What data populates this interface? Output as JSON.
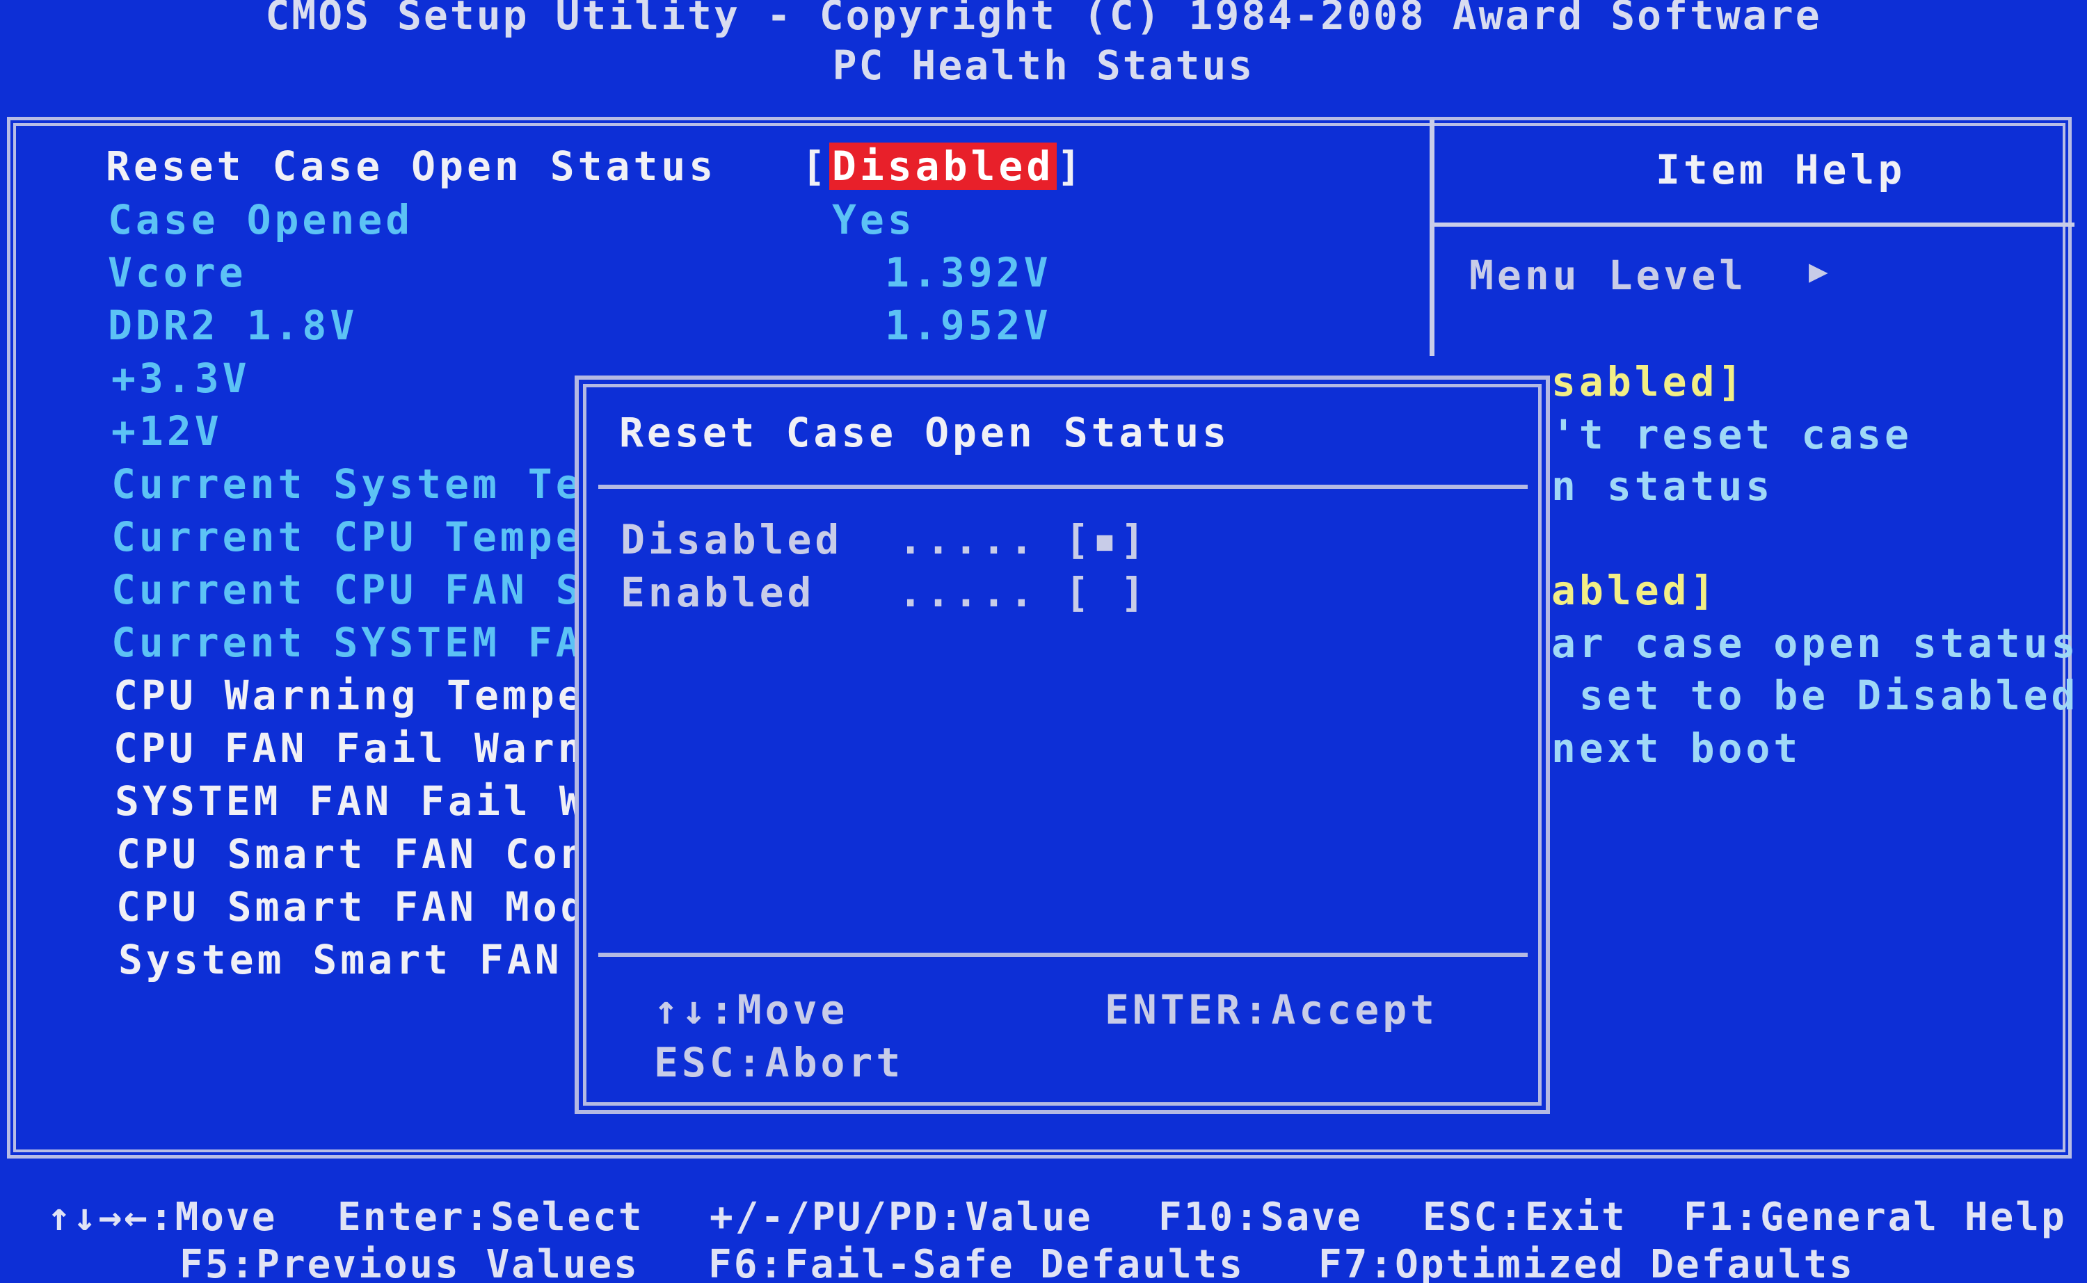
{
  "header": {
    "title": "CMOS Setup Utility - Copyright (C) 1984-2008 Award Software",
    "subtitle": "PC Health Status"
  },
  "menu": {
    "selected_item": {
      "label": "Reset Case Open Status",
      "value_left_bracket": "[",
      "value": "Disabled",
      "value_right_bracket": "]"
    },
    "items": [
      {
        "label": "Case Opened",
        "value": "Yes"
      },
      {
        "label": "Vcore",
        "value": "1.392V"
      },
      {
        "label": "DDR2 1.8V",
        "value": "1.952V"
      },
      {
        "label": "+3.3V",
        "value": ""
      },
      {
        "label": "+12V",
        "value": ""
      },
      {
        "label": "Current System Te",
        "value": ""
      },
      {
        "label": "Current CPU Tempe",
        "value": ""
      },
      {
        "label": "Current CPU FAN S",
        "value": ""
      },
      {
        "label": "Current SYSTEM FA",
        "value": ""
      },
      {
        "label": "CPU Warning Tempe",
        "value": ""
      },
      {
        "label": "CPU FAN Fail Warn",
        "value": ""
      },
      {
        "label": "SYSTEM FAN Fail W",
        "value": ""
      },
      {
        "label": "CPU Smart FAN Con",
        "value": ""
      },
      {
        "label": "CPU Smart FAN Mod",
        "value": ""
      },
      {
        "label": "System Smart FAN",
        "value": ""
      }
    ]
  },
  "help": {
    "title": "Item Help",
    "menu_level": "Menu Level",
    "menu_level_arrow": "▶",
    "lines": [
      "sabled]",
      "'t reset case",
      "n status",
      "abled]",
      "ar case open status",
      " set to be Disabled",
      "next boot"
    ]
  },
  "popup": {
    "title": "Reset Case Open Status",
    "options": [
      {
        "label": "Disabled",
        "dots": ".....",
        "marker": "[▪]"
      },
      {
        "label": "Enabled",
        "dots": ".....",
        "marker": "[ ]"
      }
    ],
    "hint_move": "↑↓:Move",
    "hint_accept": "ENTER:Accept",
    "hint_abort": "ESC:Abort"
  },
  "footer": {
    "row1": [
      "↑↓→←:Move",
      "Enter:Select",
      "+/-/PU/PD:Value",
      "F10:Save",
      "ESC:Exit",
      "F1:General Help"
    ],
    "row2": [
      "F5:Previous Values",
      "F6:Fail-Safe Defaults",
      "F7:Optimized Defaults"
    ]
  },
  "colors": {
    "background": "#0d2fd6",
    "highlight": "#e8202a",
    "label_white": "#f0f0f6",
    "label_cyan": "#5cc2f5",
    "help_yellow": "#f2ee86"
  }
}
